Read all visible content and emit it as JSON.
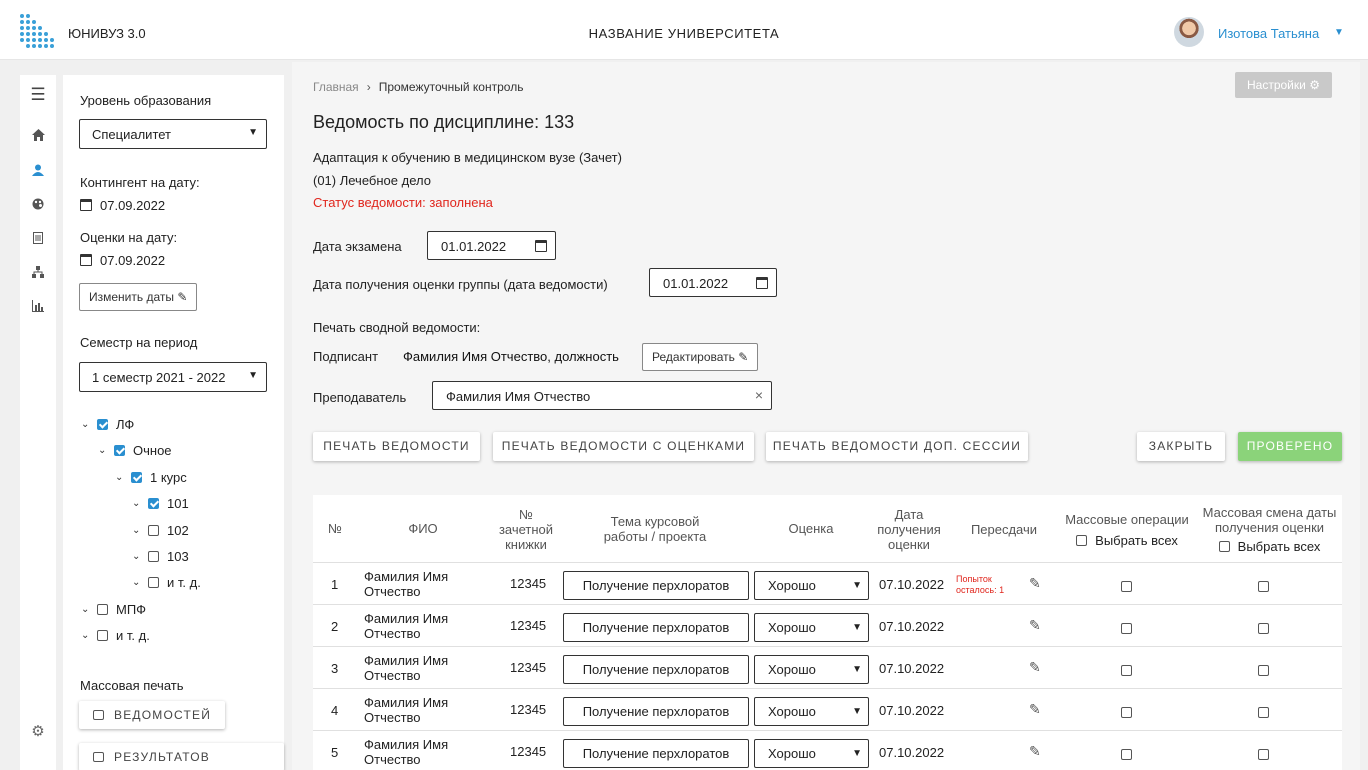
{
  "header": {
    "app_name": "ЮНИВУЗ 3.0",
    "university": "НАЗВАНИЕ УНИВЕРСИТЕТА",
    "user": "Изотова Татьяна"
  },
  "filter": {
    "education_level_label": "Уровень образования",
    "education_level_value": "Специалитет",
    "contingent_label": "Контингент на дату:",
    "contingent_date": "07.09.2022",
    "grades_label": "Оценки на дату:",
    "grades_date": "07.09.2022",
    "change_dates_button": "Изменить даты",
    "semester_label": "Семестр на период",
    "semester_value": "1 семестр 2021 - 2022",
    "tree": [
      {
        "label": "ЛФ",
        "checked": true
      },
      {
        "label": "Очное",
        "checked": true
      },
      {
        "label": "1 курс",
        "checked": true
      },
      {
        "label": "101",
        "checked": true
      },
      {
        "label": "102",
        "checked": false
      },
      {
        "label": "103",
        "checked": false
      },
      {
        "label": "и т. д.",
        "checked": false
      },
      {
        "label": "МПФ",
        "checked": false
      },
      {
        "label": "и т. д.",
        "checked": false
      }
    ],
    "mass_print_label": "Массовая печать",
    "print_sheets_button": "ВЕДОМОСТЕЙ",
    "print_results_button": "РЕЗУЛЬТАТОВ СЕССИИ"
  },
  "breadcrumb": {
    "home": "Главная",
    "current": "Промежуточный контроль"
  },
  "settings_button": "Настройки",
  "page": {
    "title": "Ведомость по дисциплине: 133",
    "discipline": "Адаптация к обучению в медицинском вузе (Зачет)",
    "specialty": "(01) Лечебное дело",
    "status": "Статус ведомости: заполнена",
    "exam_date_label": "Дата экзамена",
    "exam_date": "01.01.2022",
    "group_date_label": "Дата получения оценки группы (дата ведомости)",
    "group_date": "01.01.2022",
    "summary_print_label": "Печать сводной ведомости:",
    "signer_label": "Подписант",
    "signer_value": "Фамилия Имя Отчество, должность",
    "edit_button": "Редактировать",
    "teacher_label": "Преподаватель",
    "teacher_value": "Фамилия Имя Отчество"
  },
  "actions": {
    "print_sheet": "ПЕЧАТЬ ВЕДОМОСТИ",
    "print_with_grades": "ПЕЧАТЬ ВЕДОМОСТИ С ОЦЕНКАМИ",
    "print_extra_session": "ПЕЧАТЬ ВЕДОМОСТИ ДОП. СЕССИИ",
    "close": "ЗАКРЫТЬ",
    "checked": "ПРОВЕРЕНО"
  },
  "table": {
    "col_num": "№",
    "col_fio": "ФИО",
    "col_book_1": "№",
    "col_book_2": "зачетной",
    "col_book_3": "книжки",
    "col_topic_1": "Тема курсовой",
    "col_topic_2": "работы / проекта",
    "col_grade": "Оценка",
    "col_date_1": "Дата",
    "col_date_2": "получения",
    "col_date_3": "оценки",
    "col_retakes": "Пересдачи",
    "col_mass_ops": "Массовые операции",
    "select_all_1": "Выбрать всех",
    "col_mass_date_1": "Массовая смена даты",
    "col_mass_date_2": "получения оценки",
    "select_all_2": "Выбрать всех",
    "retake_note_1": "Попыток",
    "retake_note_2": "осталось: 1",
    "rows": [
      {
        "num": "1",
        "fio_1": "Фамилия Имя",
        "fio_2": "Отчество",
        "book": "12345",
        "topic": "Получение перхлоратов",
        "grade": "Хорошо",
        "date": "07.10.2022"
      },
      {
        "num": "2",
        "fio_1": "Фамилия Имя",
        "fio_2": "Отчество",
        "book": "12345",
        "topic": "Получение перхлоратов",
        "grade": "Хорошо",
        "date": "07.10.2022"
      },
      {
        "num": "3",
        "fio_1": "Фамилия Имя",
        "fio_2": "Отчество",
        "book": "12345",
        "topic": "Получение перхлоратов",
        "grade": "Хорошо",
        "date": "07.10.2022"
      },
      {
        "num": "4",
        "fio_1": "Фамилия Имя",
        "fio_2": "Отчество",
        "book": "12345",
        "topic": "Получение перхлоратов",
        "grade": "Хорошо",
        "date": "07.10.2022"
      },
      {
        "num": "5",
        "fio_1": "Фамилия Имя",
        "fio_2": "Отчество",
        "book": "12345",
        "topic": "Получение перхлоратов",
        "grade": "Хорошо",
        "date": "07.10.2022"
      }
    ]
  },
  "icons": [
    "menu-icon",
    "home-icon",
    "user-icon",
    "palette-icon",
    "document-icon",
    "hierarchy-icon",
    "chart-icon",
    "gear-icon",
    "calendar-icon",
    "pencil-icon",
    "printer-icon",
    "close-icon"
  ],
  "colors": {
    "accent": "#2a8fd0",
    "status_red": "#e0261d",
    "green_button": "#8bd37a",
    "settings_gray": "#c9c9c9"
  }
}
